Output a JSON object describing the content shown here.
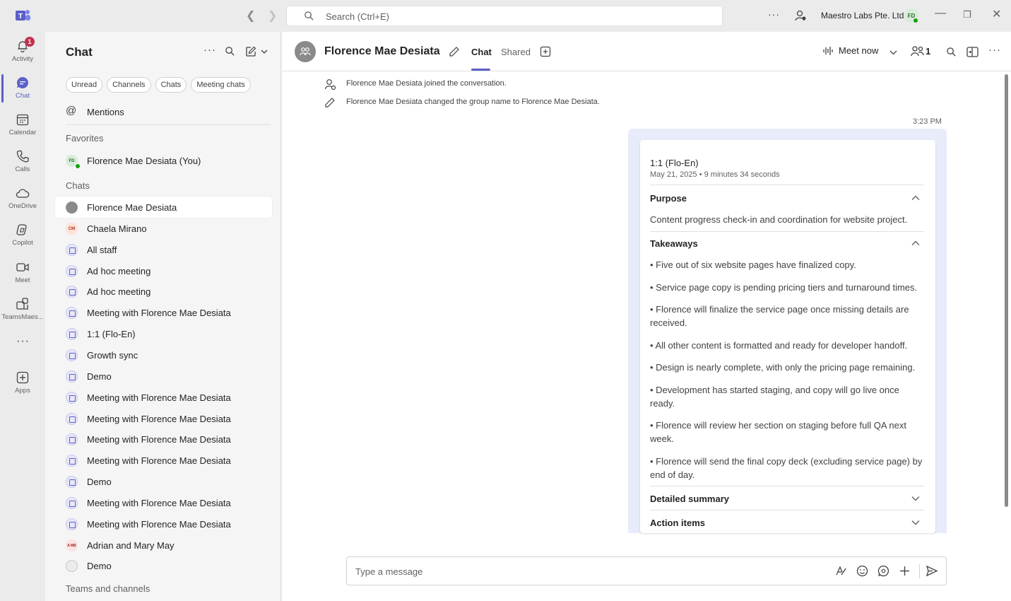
{
  "titlebar": {
    "search_placeholder": "Search (Ctrl+E)",
    "org_name": "Maestro Labs Pte. Ltd.",
    "user_initials": "FD"
  },
  "rail": {
    "items": [
      {
        "label": "Activity",
        "icon": "bell-icon",
        "badge": "1"
      },
      {
        "label": "Chat",
        "icon": "chat-icon"
      },
      {
        "label": "Calendar",
        "icon": "calendar-icon"
      },
      {
        "label": "Calls",
        "icon": "phone-icon"
      },
      {
        "label": "OneDrive",
        "icon": "cloud-icon"
      },
      {
        "label": "Copilot",
        "icon": "copilot-icon"
      },
      {
        "label": "Meet",
        "icon": "video-icon"
      },
      {
        "label": "TeamsMaes...",
        "icon": "app-icon"
      },
      {
        "label": "Apps",
        "icon": "add-app-icon"
      }
    ]
  },
  "chatlist": {
    "title": "Chat",
    "filters": [
      "Unread",
      "Channels",
      "Chats",
      "Meeting chats"
    ],
    "mentions": "Mentions",
    "favorites_header": "Favorites",
    "favorites": [
      {
        "name": "Florence Mae Desiata (You)",
        "initials": "FD"
      }
    ],
    "chats_header": "Chats",
    "chats": [
      {
        "name": "Florence Mae Desiata",
        "type": "gray"
      },
      {
        "name": "Chaela Mirano",
        "type": "cm",
        "initials": "CM"
      },
      {
        "name": "All staff",
        "type": "group"
      },
      {
        "name": "Ad hoc meeting",
        "type": "group"
      },
      {
        "name": "Ad hoc meeting",
        "type": "group"
      },
      {
        "name": "Meeting with Florence Mae Desiata",
        "type": "group"
      },
      {
        "name": "1:1 (Flo-En)",
        "type": "group"
      },
      {
        "name": "Growth sync",
        "type": "group"
      },
      {
        "name": "Demo",
        "type": "group"
      },
      {
        "name": "Meeting with Florence Mae Desiata",
        "type": "group"
      },
      {
        "name": "Meeting with Florence Mae Desiata",
        "type": "group"
      },
      {
        "name": "Meeting with Florence Mae Desiata",
        "type": "group"
      },
      {
        "name": "Meeting with Florence Mae Desiata",
        "type": "group"
      },
      {
        "name": "Demo",
        "type": "group"
      },
      {
        "name": "Meeting with Florence Mae Desiata",
        "type": "group"
      },
      {
        "name": "Meeting with Florence Mae Desiata",
        "type": "group"
      },
      {
        "name": "Adrian and Mary May",
        "type": "am",
        "initials": "A MB"
      },
      {
        "name": "Demo",
        "type": "demo-off"
      }
    ],
    "teams_header": "Teams and channels"
  },
  "header": {
    "name": "Florence Mae Desiata",
    "tabs": [
      "Chat",
      "Shared"
    ],
    "meet_now": "Meet now",
    "participants": "1"
  },
  "messages": {
    "system": [
      "Florence Mae Desiata joined the conversation.",
      "Florence Mae Desiata changed the group name to Florence Mae Desiata."
    ],
    "timestamp": "3:23 PM"
  },
  "recap": {
    "title": "1:1 (Flo-En)",
    "subtitle": "May 21, 2025 • 9 minutes 34 seconds",
    "purpose_label": "Purpose",
    "purpose_text": "Content progress check-in and coordination for website project.",
    "takeaways_label": "Takeaways",
    "takeaways": [
      "• Five out of six website pages have finalized copy.",
      "• Service page copy is pending pricing tiers and turnaround times.",
      "• Florence will finalize the service page once missing details are received.",
      "• All other content is formatted and ready for developer handoff.",
      "• Design is nearly complete, with only the pricing page remaining.",
      "• Development has started staging, and copy will go live once ready.",
      "• Florence will review her section on staging before full QA next week.",
      "• Florence will send the final copy deck (excluding service page) by end of day."
    ],
    "detailed_summary_label": "Detailed summary",
    "action_items_label": "Action items"
  },
  "compose": {
    "placeholder": "Type a message"
  },
  "colors": {
    "accent": "#5b5fc7",
    "presence": "#13a10e",
    "badge": "#c4314b"
  }
}
